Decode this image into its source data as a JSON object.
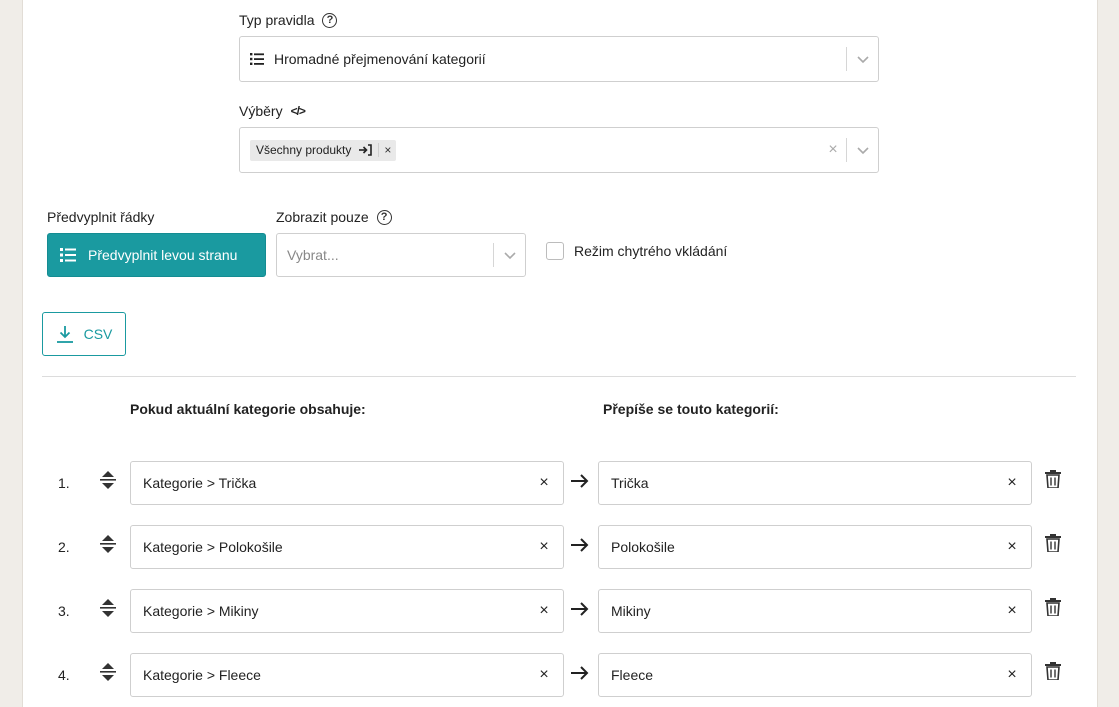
{
  "rule_type": {
    "label": "Typ pravidla",
    "help": "?",
    "selected": "Hromadné přejmenování kategorií"
  },
  "selections": {
    "label": "Výběry",
    "code_icon": "</>",
    "chip_label": "Všechny produkty",
    "chip_remove": "×",
    "clear": "×"
  },
  "prefill": {
    "label": "Předvyplnit řádky",
    "button_label": "Předvyplnit levou stranu"
  },
  "show_only": {
    "label": "Zobrazit pouze",
    "help": "?",
    "placeholder": "Vybrat..."
  },
  "smart_insert": {
    "label": "Režim chytrého vkládání",
    "checked": false
  },
  "csv_button": {
    "label": "CSV"
  },
  "columns": {
    "left": "Pokud aktuální kategorie obsahuje:",
    "right": "Přepíše se touto kategorií:"
  },
  "rows": [
    {
      "num": "1.",
      "from": "Kategorie > Trička",
      "to": "Trička"
    },
    {
      "num": "2.",
      "from": "Kategorie > Polokošile",
      "to": "Polokošile"
    },
    {
      "num": "3.",
      "from": "Kategorie > Mikiny",
      "to": "Mikiny"
    },
    {
      "num": "4.",
      "from": "Kategorie > Fleece",
      "to": "Fleece"
    }
  ],
  "clear_glyph": "×",
  "colors": {
    "accent": "#1a9aa0",
    "background": "#f0ede8",
    "panel": "#ffffff"
  },
  "icons": {
    "list": "list-icon",
    "chevron": "chevron-down-icon",
    "download": "download-icon",
    "drag": "drag-handle-icon",
    "arrow": "arrow-right-icon",
    "trash": "trash-icon",
    "exit": "exit-icon"
  }
}
